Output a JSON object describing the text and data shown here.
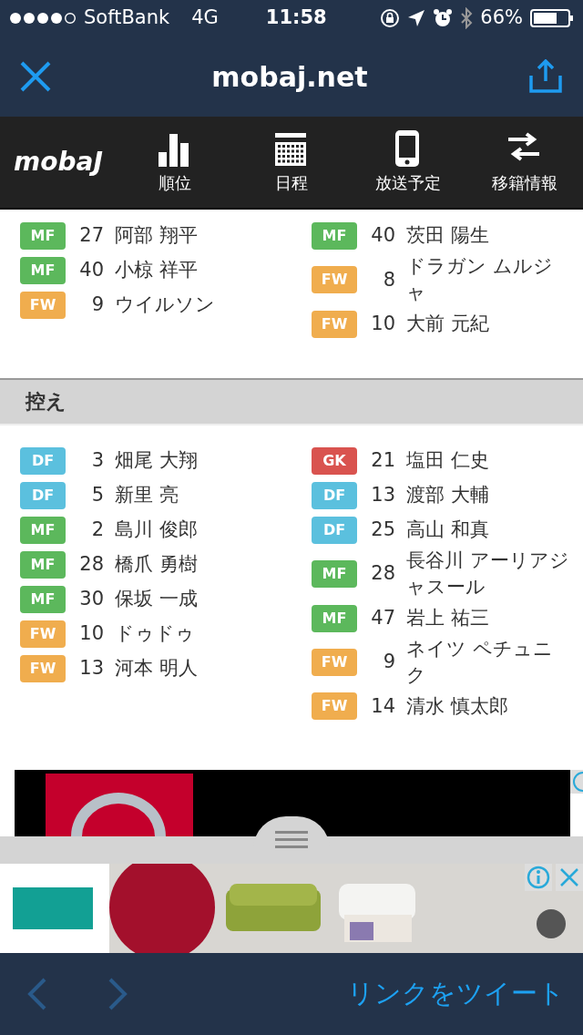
{
  "status_bar": {
    "carrier": "SoftBank",
    "network": "4G",
    "time": "11:58",
    "battery": "66%"
  },
  "browser": {
    "title": "mobaj.net"
  },
  "site_menu": {
    "logo": "mobaJ",
    "items": [
      {
        "label": "順位",
        "kind": "chart"
      },
      {
        "label": "日程",
        "kind": "calendar"
      },
      {
        "label": "放送予定",
        "kind": "phone"
      },
      {
        "label": "移籍情報",
        "kind": "transfer"
      }
    ]
  },
  "starters": {
    "left": [
      {
        "position": "MF",
        "color": "#5cb85c",
        "number": "27",
        "name": "阿部 翔平"
      },
      {
        "position": "MF",
        "color": "#5cb85c",
        "number": "40",
        "name": "小椋 祥平"
      },
      {
        "position": "FW",
        "color": "#f0ad4e",
        "number": "9",
        "name": "ウイルソン"
      }
    ],
    "right": [
      {
        "position": "MF",
        "color": "#5cb85c",
        "number": "40",
        "name": "茨田 陽生"
      },
      {
        "position": "FW",
        "color": "#f0ad4e",
        "number": "8",
        "name": "ドラガン ムルジャ"
      },
      {
        "position": "FW",
        "color": "#f0ad4e",
        "number": "10",
        "name": "大前 元紀"
      }
    ]
  },
  "substitutes": {
    "title": "控え",
    "left": [
      {
        "position": "DF",
        "color": "#5bc0de",
        "number": "3",
        "name": "畑尾 大翔"
      },
      {
        "position": "DF",
        "color": "#5bc0de",
        "number": "5",
        "name": "新里 亮"
      },
      {
        "position": "MF",
        "color": "#5cb85c",
        "number": "2",
        "name": "島川 俊郎"
      },
      {
        "position": "MF",
        "color": "#5cb85c",
        "number": "28",
        "name": "橋爪 勇樹"
      },
      {
        "position": "MF",
        "color": "#5cb85c",
        "number": "30",
        "name": "保坂 一成"
      },
      {
        "position": "FW",
        "color": "#f0ad4e",
        "number": "10",
        "name": "ドゥドゥ"
      },
      {
        "position": "FW",
        "color": "#f0ad4e",
        "number": "13",
        "name": "河本 明人"
      }
    ],
    "right": [
      {
        "position": "GK",
        "color": "#d9534f",
        "number": "21",
        "name": "塩田 仁史"
      },
      {
        "position": "DF",
        "color": "#5bc0de",
        "number": "13",
        "name": "渡部 大輔"
      },
      {
        "position": "DF",
        "color": "#5bc0de",
        "number": "25",
        "name": "高山 和真"
      },
      {
        "position": "MF",
        "color": "#5cb85c",
        "number": "28",
        "name": "長谷川 アーリアジャスール"
      },
      {
        "position": "MF",
        "color": "#5cb85c",
        "number": "47",
        "name": "岩上 祐三"
      },
      {
        "position": "FW",
        "color": "#f0ad4e",
        "number": "9",
        "name": "ネイツ ペチュニク"
      },
      {
        "position": "FW",
        "color": "#f0ad4e",
        "number": "14",
        "name": "清水 慎太郎"
      }
    ]
  },
  "toolbar": {
    "back_disabled": true,
    "forward_disabled": true,
    "action": "リンクをツイート"
  }
}
